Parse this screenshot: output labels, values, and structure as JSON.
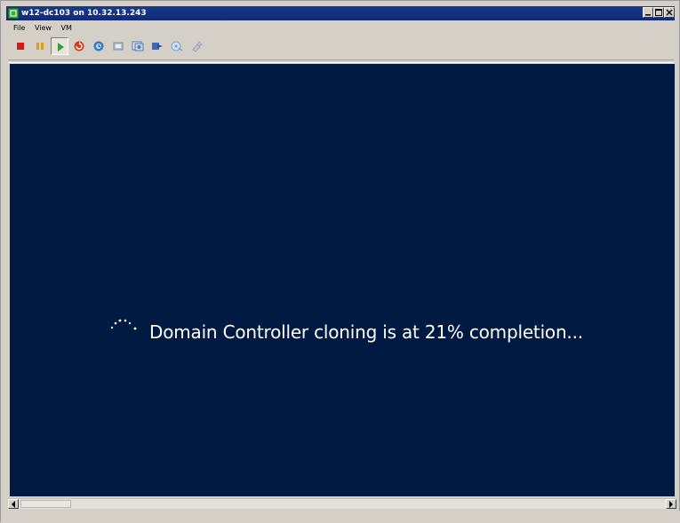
{
  "window": {
    "title": "w12-dc103 on 10.32.13.243"
  },
  "menu": {
    "items": [
      "File",
      "View",
      "VM"
    ]
  },
  "toolbar": {
    "buttons": [
      {
        "name": "stop",
        "icon": "stop-icon",
        "color": "#d81818"
      },
      {
        "name": "pause",
        "icon": "pause-icon",
        "color": "#e59a1a"
      },
      {
        "name": "play",
        "icon": "play-icon",
        "color": "#2aa52a",
        "pressed": true
      },
      {
        "name": "reset",
        "icon": "reset-icon",
        "color": "#d83a1a"
      },
      {
        "name": "snapshot",
        "icon": "snapshot-icon",
        "color": "#3a78c8"
      },
      {
        "name": "revert-snapshot",
        "icon": "revert-snapshot-icon",
        "color": "#8a9aaa"
      },
      {
        "name": "snapshot-manager",
        "icon": "snapshot-manager-icon",
        "color": "#5a7aaa"
      },
      {
        "name": "send-ctrl-alt-del",
        "icon": "send-ctrl-alt-del-icon",
        "color": "#3a6ab8"
      },
      {
        "name": "connect-cd",
        "icon": "connect-cd-icon",
        "color": "#7aa0c8"
      },
      {
        "name": "connect-usb",
        "icon": "connect-usb-icon",
        "color": "#9aa4b0"
      }
    ]
  },
  "console": {
    "background": "#011a42",
    "message": "Domain Controller cloning is at 21% completion..."
  }
}
